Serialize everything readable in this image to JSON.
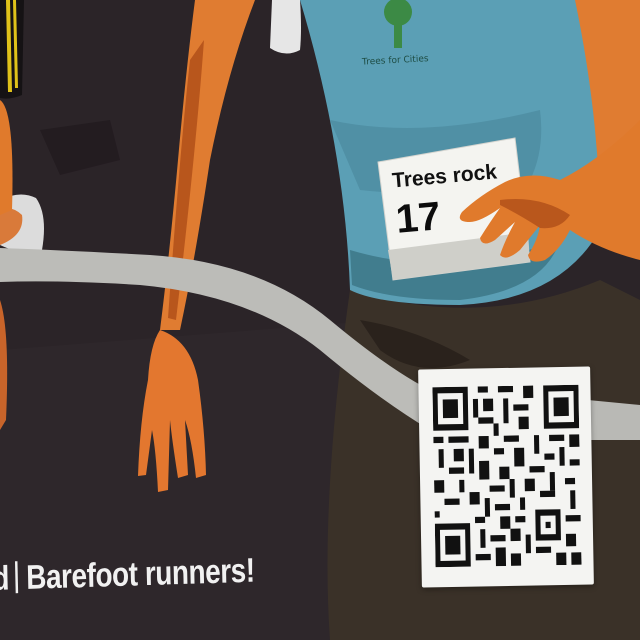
{
  "poster": {
    "shirt_text": "Trees for Cities",
    "bib_title": "Trees rock",
    "bib_number": "17",
    "tagline_left": "d",
    "tagline_right": "Barefoot runners!"
  },
  "colors": {
    "background": "#2b2428",
    "shirt": "#5b9fb5",
    "skin": "#e3772f",
    "ribbon": "#bcbcb8",
    "tagline_text": "#f1f1f1",
    "qr_card": "#f4f4f2"
  },
  "icons": [
    "tree-logo-icon",
    "qr-code-icon"
  ]
}
